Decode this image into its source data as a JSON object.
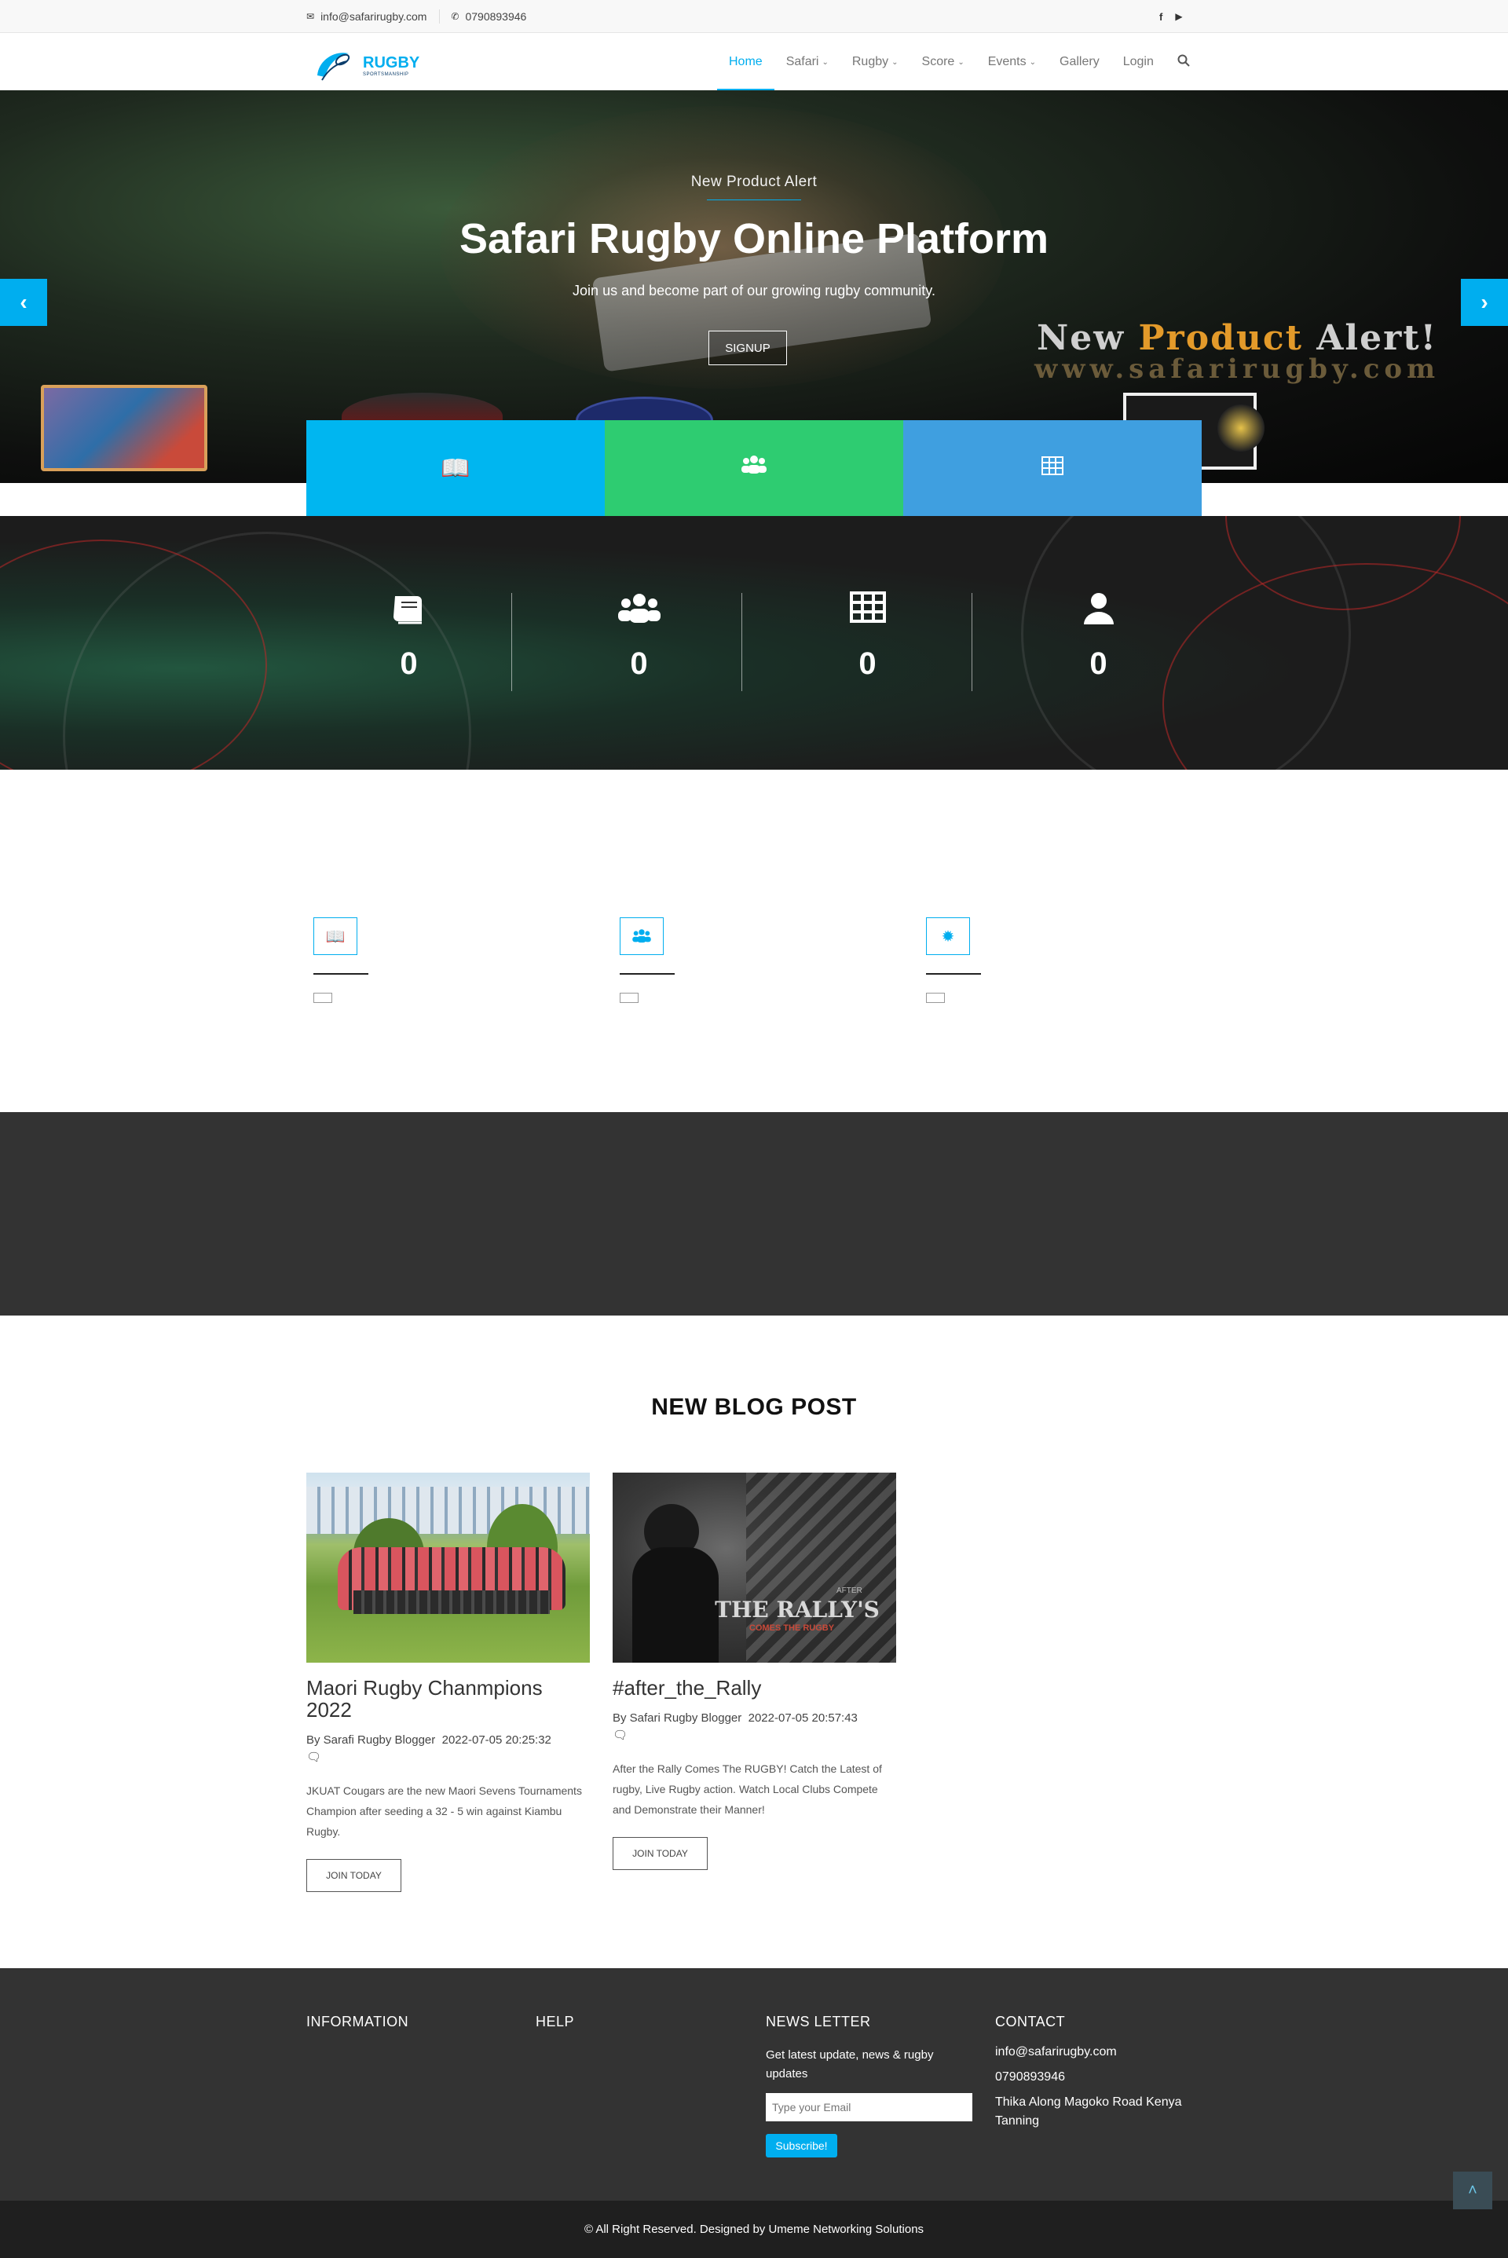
{
  "topbar": {
    "email": "info@safarirugby.com",
    "phone": "0790893946",
    "email_icon": "envelope-icon",
    "phone_icon": "phone-icon",
    "social": [
      "facebook-icon",
      "youtube-icon"
    ]
  },
  "nav": {
    "logo_text": "RUGBY",
    "logo_tagline": "SPORTSMANSHIP",
    "items": [
      {
        "label": "Home",
        "active": true,
        "dropdown": false
      },
      {
        "label": "Safari",
        "active": false,
        "dropdown": true
      },
      {
        "label": "Rugby",
        "active": false,
        "dropdown": true
      },
      {
        "label": "Score",
        "active": false,
        "dropdown": true
      },
      {
        "label": "Events",
        "active": false,
        "dropdown": true
      },
      {
        "label": "Gallery",
        "active": false,
        "dropdown": false
      },
      {
        "label": "Login",
        "active": false,
        "dropdown": false
      }
    ],
    "search_icon": "search-icon"
  },
  "hero": {
    "overline": "New Product Alert",
    "title": "Safari Rugby Online Platform",
    "subtitle": "Join us and become part of our growing rugby community.",
    "button": "SIGNUP",
    "overlay_line1_a": "New",
    "overlay_line1_b": "Product",
    "overlay_line1_c": "Alert!",
    "overlay_line2": "www.safarirugby.com",
    "prev_icon": "chevron-left-icon",
    "next_icon": "chevron-right-icon"
  },
  "features": [
    {
      "icon": "book-icon",
      "color": "#00b6f0"
    },
    {
      "icon": "users-icon",
      "color": "#2ecc71"
    },
    {
      "icon": "table-icon",
      "color": "#3f9fe0"
    }
  ],
  "stats": [
    {
      "icon": "book-icon",
      "value": "0"
    },
    {
      "icon": "users-icon",
      "value": "0"
    },
    {
      "icon": "table-icon",
      "value": "0"
    },
    {
      "icon": "user-icon",
      "value": "0"
    }
  ],
  "services": [
    {
      "icon": "book-icon"
    },
    {
      "icon": "users-icon"
    },
    {
      "icon": "badge-icon"
    }
  ],
  "blog": {
    "heading": "NEW BLOG POST",
    "posts": [
      {
        "title": "Maori Rugby Chanmpions 2022",
        "author": "By Sarafi Rugby Blogger",
        "date": "2022-07-05 20:25:32",
        "description": "JKUAT Cougars are the new Maori Sevens Tournaments Champion after seeding a 32 - 5 win against Kiambu Rugby.",
        "button": "JOIN TODAY"
      },
      {
        "title": "#after_the_Rally",
        "author": "By Safari Rugby Blogger",
        "date": "2022-07-05 20:57:43",
        "description": "After the Rally Comes The RUGBY! Catch the Latest of rugby, Live Rugby action. Watch Local Clubs Compete and Demonstrate their Manner!",
        "button": "JOIN TODAY",
        "image_text_1": "THE RALLY'S",
        "image_text_2": "COMES THE RUGBY",
        "image_text_3": "AFTER"
      }
    ]
  },
  "footer": {
    "information": "INFORMATION",
    "help": "HELP",
    "newsletter": "NEWS LETTER",
    "newsletter_text": "Get latest update, news & rugby updates",
    "email_placeholder": "Type your Email",
    "subscribe": "Subscribe!",
    "contact": "CONTACT",
    "contact_email": "info@safarirugby.com",
    "contact_phone": "0790893946",
    "contact_address": "Thika Along Magoko Road Kenya Tanning",
    "copyright": "© All Right Reserved. Designed by Umeme Networking Solutions"
  },
  "colors": {
    "accent": "#00aeef",
    "footer_bg": "#333333",
    "copyright_bg": "#1f1f1f"
  }
}
